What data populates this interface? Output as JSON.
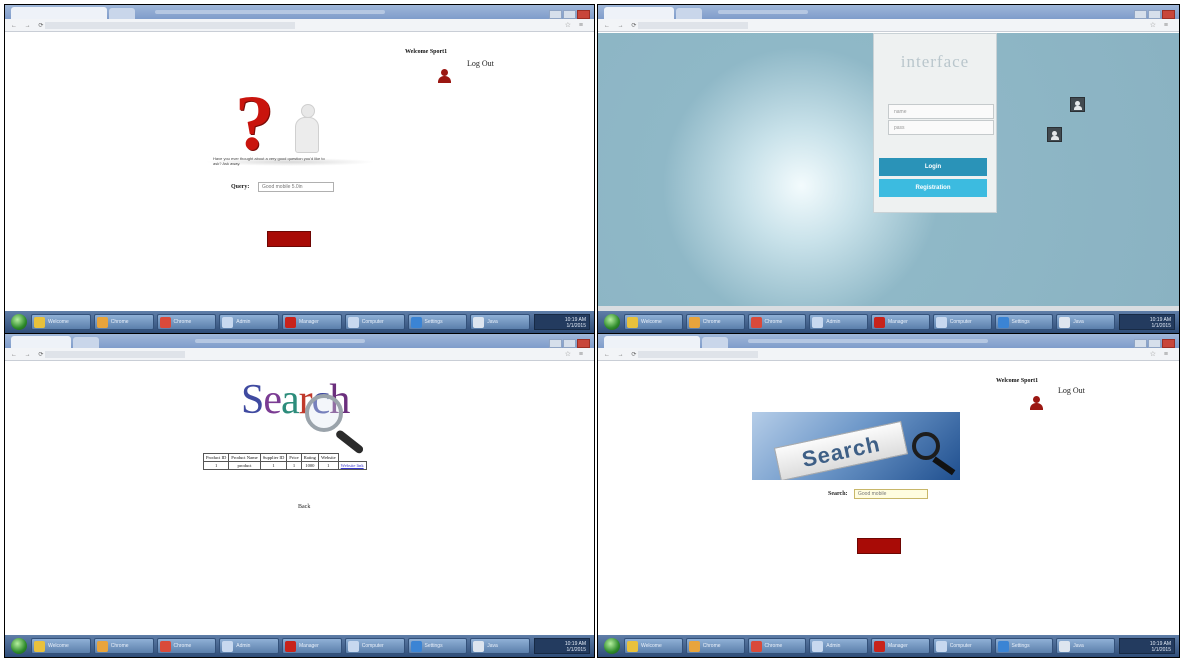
{
  "panels": {
    "p1": {
      "welcome": "Welcome Sport1",
      "logout": "Log Out",
      "question_text": "Have you ever thought about a very good question you'd like to ask? Ask away.",
      "query_label": "Query:",
      "query_value": "Good mobile 5.0in"
    },
    "p2": {
      "title": "interface",
      "username_placeholder": "name",
      "password_placeholder": "pass",
      "login_label": "Login",
      "register_label": "Registration"
    },
    "p3": {
      "logo_letters": [
        "S",
        "e",
        "a",
        "r",
        "c",
        "h"
      ],
      "table": {
        "headers": [
          "Product ID",
          "Product Name",
          "Supplier ID",
          "Price",
          "Rating",
          "Website"
        ],
        "rows": [
          [
            "1",
            "product",
            "1",
            "1",
            "1000",
            "1",
            "Website link"
          ]
        ]
      },
      "back_label": "Back"
    },
    "p4": {
      "welcome": "Welcome Sport1",
      "logout": "Log Out",
      "banner_word": "Search",
      "search_label": "Search:",
      "search_value": "Good mobile"
    }
  },
  "colors": {
    "accent_red": "#a80b06",
    "login_btn": "#2a93b8",
    "register_btn": "#3cbbe0",
    "logo_colors": [
      "#3f4aa0",
      "#7b3c93",
      "#2c8c7b",
      "#c0392b",
      "#3f4aa0",
      "#6b2f7d"
    ]
  },
  "taskbar_items": [
    {
      "label": "Welcome",
      "icon": "folder-icon",
      "color": "#e8c13c"
    },
    {
      "label": "Chrome",
      "icon": "chrome-icon",
      "color": "#e8a43c"
    },
    {
      "label": "Chrome",
      "icon": "chrome-icon",
      "color": "#d94a3a"
    },
    {
      "label": "Admin",
      "icon": "window-icon",
      "color": "#c7d8ef"
    },
    {
      "label": "Manager",
      "icon": "acrobat-icon",
      "color": "#c8231b"
    },
    {
      "label": "Computer",
      "icon": "computer-icon",
      "color": "#c7d8ef"
    },
    {
      "label": "Settings",
      "icon": "globe-icon",
      "color": "#3b84d4"
    },
    {
      "label": "Java",
      "icon": "java-icon",
      "color": "#dde5ef"
    }
  ],
  "tray_time": "10:19 AM",
  "tray_date": "1/1/2015"
}
